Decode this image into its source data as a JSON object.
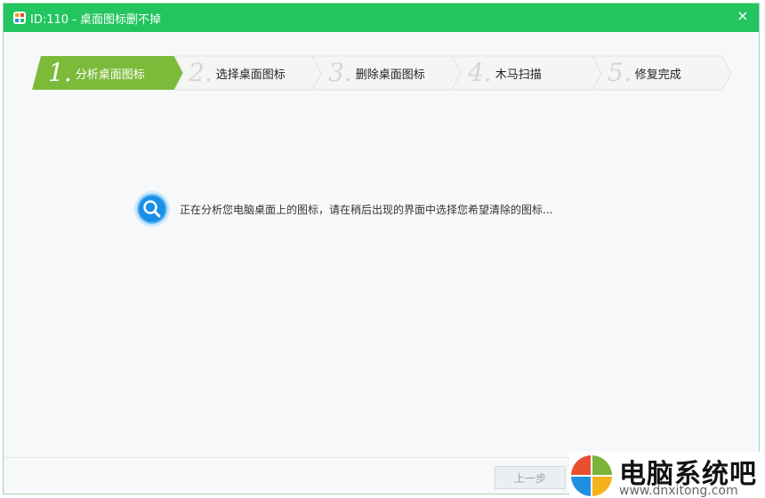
{
  "window": {
    "title": "ID:110 - 桌面图标删不掉",
    "close_glyph": "×"
  },
  "colors": {
    "titlebar": "#22c55e",
    "step_active": "#7cbb3a",
    "step_inactive": "#f5f5f3",
    "accent_blue": "#1a8fe6"
  },
  "icons": [
    "app-icon",
    "close-icon",
    "search-magnifier-icon",
    "windows-logo-icon"
  ],
  "steps": [
    {
      "num": "1.",
      "label": "分析桌面图标",
      "active": true
    },
    {
      "num": "2.",
      "label": "选择桌面图标",
      "active": false
    },
    {
      "num": "3.",
      "label": "删除桌面图标",
      "active": false
    },
    {
      "num": "4.",
      "label": "木马扫描",
      "active": false
    },
    {
      "num": "5.",
      "label": "修复完成",
      "active": false
    }
  ],
  "status": {
    "text": "正在分析您电脑桌面上的图标，请在稍后出现的界面中选择您希望清除的图标..."
  },
  "footer": {
    "prev_label": "上一步"
  },
  "watermark": {
    "brand": "电脑系统吧",
    "url": "www.dnxitong.com"
  }
}
